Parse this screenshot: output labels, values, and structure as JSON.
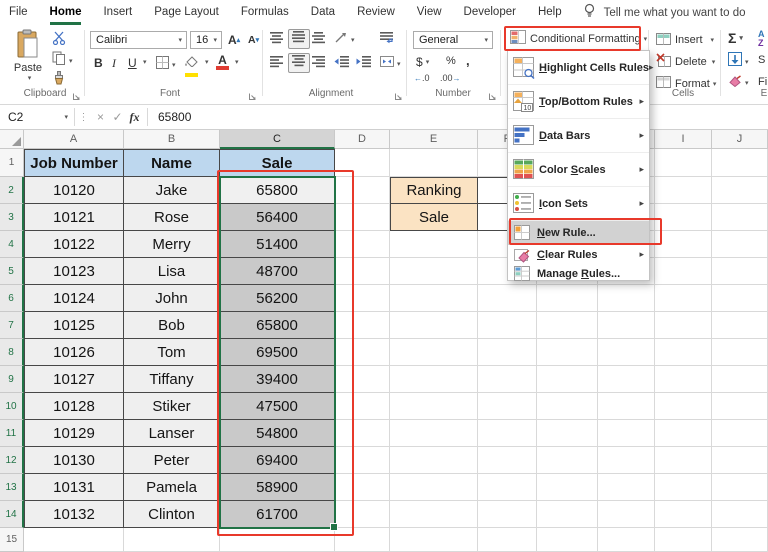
{
  "menu_bar": {
    "tabs": [
      {
        "label": "File"
      },
      {
        "label": "Home"
      },
      {
        "label": "Insert"
      },
      {
        "label": "Page Layout"
      },
      {
        "label": "Formulas"
      },
      {
        "label": "Data"
      },
      {
        "label": "Review"
      },
      {
        "label": "View"
      },
      {
        "label": "Developer"
      },
      {
        "label": "Help"
      }
    ],
    "active_tab": "Home",
    "tell_me": "Tell me what you want to do"
  },
  "ribbon": {
    "clipboard": {
      "paste_label": "Paste",
      "group_label": "Clipboard"
    },
    "font": {
      "font_name": "Calibri",
      "font_size": "16",
      "bold": "B",
      "italic": "I",
      "underline": "U",
      "group_label": "Font"
    },
    "alignment": {
      "group_label": "Alignment"
    },
    "number": {
      "format": "General",
      "currency": "$",
      "percent": "%",
      "comma": ",",
      "group_label": "Number"
    },
    "styles": {
      "conditional_formatting_label": "Conditional Formatting"
    },
    "cells": {
      "insert_label": "Insert",
      "delete_label": "Delete",
      "format_label": "Format",
      "group_label": "Cells"
    },
    "editing": {
      "autosum_glyph": "Σ",
      "partial_label_1": "S",
      "partial_label_2": "Fi",
      "group_label_partial": "E"
    }
  },
  "formula_bar": {
    "name_box": "C2",
    "fx_label": "fx",
    "value": "65800"
  },
  "context_menu": {
    "items": [
      {
        "pre": "",
        "u": "H",
        "post": "ighlight Cells Rules",
        "icon": "menu-hcr",
        "submenu": true,
        "size": "big",
        "highlighted": false
      },
      {
        "pre": "",
        "u": "T",
        "post": "op/Bottom Rules",
        "icon": "menu-tbr",
        "submenu": true,
        "size": "big",
        "highlighted": false
      },
      {
        "pre": "",
        "u": "D",
        "post": "ata Bars",
        "icon": "menu-db",
        "submenu": true,
        "size": "big",
        "highlighted": false
      },
      {
        "pre": "Color ",
        "u": "S",
        "post": "cales",
        "icon": "menu-cs",
        "submenu": true,
        "size": "big",
        "highlighted": false
      },
      {
        "pre": "",
        "u": "I",
        "post": "con Sets",
        "icon": "menu-is",
        "submenu": true,
        "size": "big",
        "highlighted": false
      },
      {
        "pre": "",
        "u": "N",
        "post": "ew Rule...",
        "icon": "menu-nr",
        "submenu": false,
        "size": "nr",
        "highlighted": true
      },
      {
        "pre": "",
        "u": "C",
        "post": "lear Rules",
        "icon": "menu-cr",
        "submenu": true,
        "size": "small",
        "highlighted": false
      },
      {
        "pre": "Manage ",
        "u": "R",
        "post": "ules...",
        "icon": "menu-mr",
        "submenu": false,
        "size": "small",
        "highlighted": false
      }
    ]
  },
  "sheet": {
    "column_headers": [
      "A",
      "B",
      "C",
      "D",
      "E",
      "F",
      "G",
      "H",
      "I",
      "J"
    ],
    "selected_column": "C",
    "selected_rows_from": 2,
    "selected_rows_to": 14,
    "visible_row_count": 15,
    "table": {
      "headers": [
        "Job Number",
        "Name",
        "Sale"
      ],
      "rows": [
        [
          "10120",
          "Jake",
          "65800"
        ],
        [
          "10121",
          "Rose",
          "56400"
        ],
        [
          "10122",
          "Merry",
          "51400"
        ],
        [
          "10123",
          "Lisa",
          "48700"
        ],
        [
          "10124",
          "John",
          "56200"
        ],
        [
          "10125",
          "Bob",
          "65800"
        ],
        [
          "10126",
          "Tom",
          "69500"
        ],
        [
          "10127",
          "Tiffany",
          "39400"
        ],
        [
          "10128",
          "Stiker",
          "47500"
        ],
        [
          "10129",
          "Lanser",
          "54800"
        ],
        [
          "10130",
          "Peter",
          "69400"
        ],
        [
          "10131",
          "Pamela",
          "58900"
        ],
        [
          "10132",
          "Clinton",
          "61700"
        ]
      ]
    },
    "side_labels": {
      "ranking": "Ranking",
      "sale": "Sale"
    }
  },
  "colors": {
    "accent_green": "#217346",
    "annotation_red": "#E8392B",
    "table_header_fill": "#BDD7EE",
    "side_label_fill": "#FBE3C3",
    "selection_fill": "#C9C9C9"
  }
}
